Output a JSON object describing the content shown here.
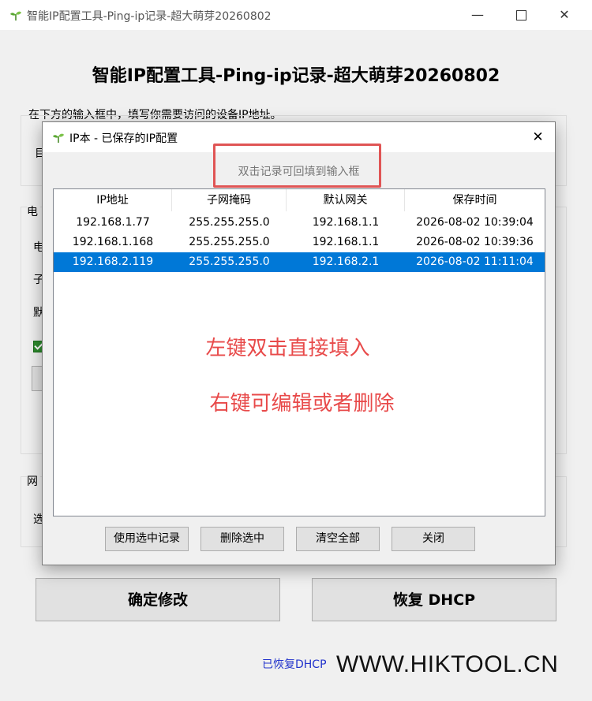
{
  "main": {
    "window_title": "智能IP配置工具-Ping-ip记录-超大萌芽20260802",
    "heading": "智能IP配置工具-Ping-ip记录-超大萌芽20260802",
    "instruction": "在下方的输入框中，填写你需要访问的设备IP地址。",
    "partial_labels": {
      "mu": "目",
      "dian": "电",
      "dian2": "电",
      "zi": "子",
      "mo": "默",
      "wang": "网",
      "xuan": "选"
    },
    "buttons": {
      "confirm": "确定修改",
      "restore_dhcp": "恢复 DHCP"
    },
    "status": "已恢复DHCP",
    "watermark": "WWW.HIKTOOL.CN"
  },
  "window_controls": {
    "minimize": "—",
    "close": "✕"
  },
  "dialog": {
    "title": "IP本 - 已保存的IP配置",
    "close": "✕",
    "hint": "双击记录可回填到输入框",
    "columns": [
      "IP地址",
      "子网掩码",
      "默认网关",
      "保存时间"
    ],
    "rows": [
      [
        "192.168.1.77",
        "255.255.255.0",
        "192.168.1.1",
        "2026-08-02 10:39:04"
      ],
      [
        "192.168.1.168",
        "255.255.255.0",
        "192.168.1.1",
        "2026-08-02 10:39:36"
      ],
      [
        "192.168.2.119",
        "255.255.255.0",
        "192.168.2.1",
        "2026-08-02 11:11:04"
      ]
    ],
    "selected_row": 3,
    "annotations": [
      "左键双击直接填入",
      "右键可编辑或者删除"
    ],
    "buttons": [
      "使用选中记录",
      "删除选中",
      "清空全部",
      "关闭"
    ]
  },
  "colors": {
    "selection": "#0078d7",
    "annotation": "#e84a4a",
    "status": "#2233cc"
  },
  "icons": {
    "app": "sprout-icon"
  }
}
